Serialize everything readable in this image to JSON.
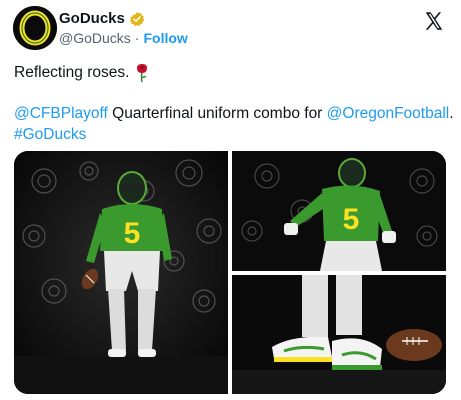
{
  "author": {
    "name": "GoDucks",
    "handle": "@GoDucks",
    "separator": "·",
    "follow_label": "Follow",
    "avatar_icon": "oregon-o-logo",
    "verified_icon": "verified-gold-badge"
  },
  "post": {
    "line1": "Reflecting roses.",
    "line1_emoji": "rose-icon",
    "mention_cfb": "@CFBPlayoff",
    "text_mid": " Quarterfinal uniform combo for ",
    "mention_oregon": "@OregonFootball",
    "text_end": ". ",
    "hashtag": "#GoDucks"
  },
  "media": {
    "images": [
      {
        "name": "player-standing-photo",
        "jersey_number": "5"
      },
      {
        "name": "player-crouching-photo",
        "jersey_number": "5"
      },
      {
        "name": "cleats-and-football-photo"
      }
    ]
  },
  "colors": {
    "link": "#1d9bf0",
    "text": "#0f1419",
    "secondary": "#536471",
    "verified_gold": "#e2b719",
    "oregon_green": "#3a8a2e",
    "oregon_yellow": "#fce122"
  }
}
